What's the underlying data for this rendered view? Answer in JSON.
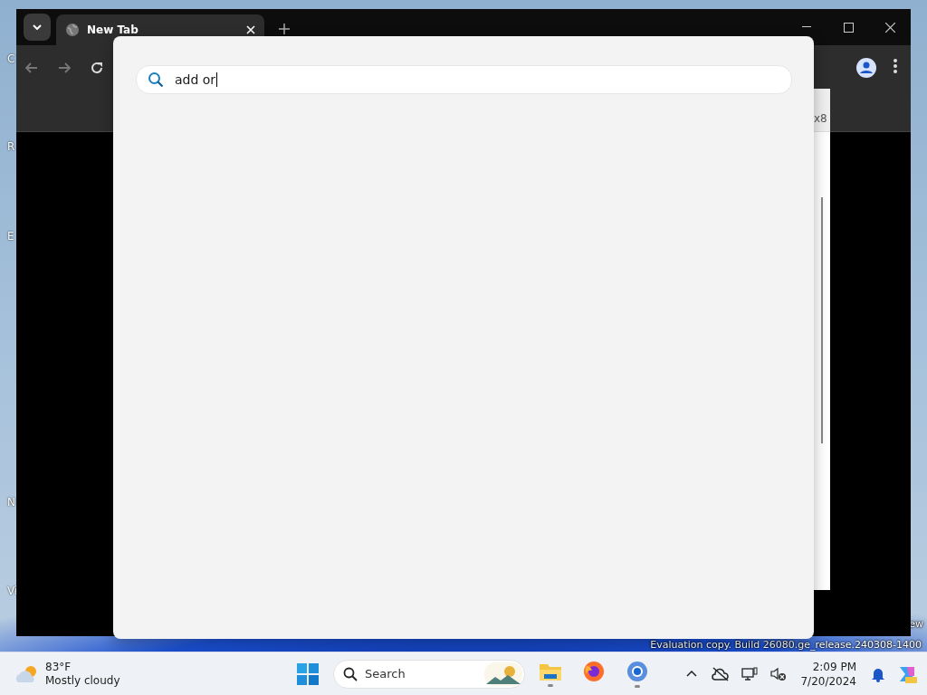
{
  "desktop": {
    "icon_labels": [
      "C",
      "R",
      "E",
      "N",
      "Vi"
    ],
    "watermark": "Evaluation copy. Build 26080.ge_release.240308-1400",
    "watermark_tail": "ew"
  },
  "browser": {
    "tabs": [
      {
        "title": "New Tab",
        "selected": true
      }
    ],
    "behind_text": "x8"
  },
  "search_panel": {
    "query": "add or"
  },
  "taskbar": {
    "weather": {
      "temperature": "83°F",
      "condition": "Mostly cloudy"
    },
    "search": {
      "placeholder": "Search"
    },
    "apps": [
      {
        "kind": "files",
        "running": true
      },
      {
        "kind": "firefox",
        "running": false
      },
      {
        "kind": "chrome",
        "running": true
      }
    ],
    "clock": {
      "time": "2:09 PM",
      "date": "7/20/2024"
    }
  }
}
